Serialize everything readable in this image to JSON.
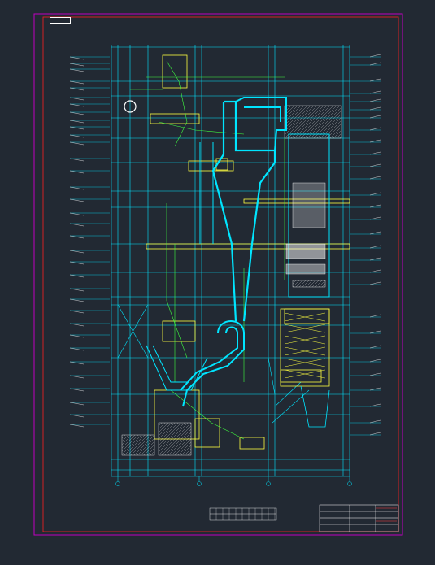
{
  "drawing": {
    "stamp_text": "",
    "title_block_text": "",
    "colors": {
      "background": "#222933",
      "frame": "#c000c0",
      "inner_frame": "#ff2020",
      "structure": "#00e5ff",
      "equipment": "#ffff40",
      "piping": "#40ff40",
      "annotation": "#ffffff",
      "hatching": "#ffffff"
    }
  }
}
